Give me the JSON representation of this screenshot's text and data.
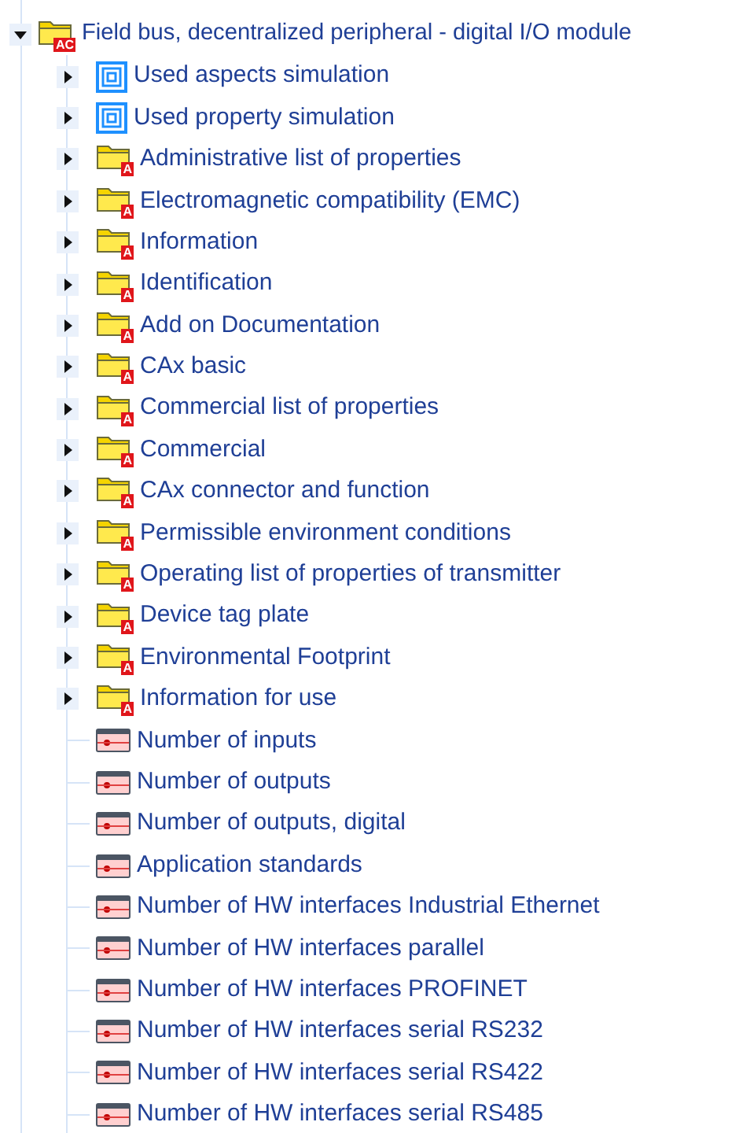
{
  "tree": {
    "label": "Field bus, decentralized peripheral - digital I/O module",
    "kind": "folder",
    "badge": "AC",
    "expanded": true,
    "children": [
      {
        "label": "Used aspects simulation",
        "kind": "collection",
        "expanded": false
      },
      {
        "label": "Used property simulation",
        "kind": "collection",
        "expanded": false
      },
      {
        "label": "Administrative list of properties",
        "kind": "folder",
        "badge": "A",
        "expanded": false
      },
      {
        "label": "Electromagnetic compatibility (EMC)",
        "kind": "folder",
        "badge": "A",
        "expanded": false
      },
      {
        "label": "Information",
        "kind": "folder",
        "badge": "A",
        "expanded": false
      },
      {
        "label": "Identification",
        "kind": "folder",
        "badge": "A",
        "expanded": false
      },
      {
        "label": "Add on Documentation",
        "kind": "folder",
        "badge": "A",
        "expanded": false
      },
      {
        "label": "CAx basic",
        "kind": "folder",
        "badge": "A",
        "expanded": false
      },
      {
        "label": "Commercial list of properties",
        "kind": "folder",
        "badge": "A",
        "expanded": false
      },
      {
        "label": "Commercial",
        "kind": "folder",
        "badge": "A",
        "expanded": false
      },
      {
        "label": "CAx connector and function",
        "kind": "folder",
        "badge": "A",
        "expanded": false
      },
      {
        "label": "Permissible environment conditions",
        "kind": "folder",
        "badge": "A",
        "expanded": false
      },
      {
        "label": "Operating list of properties of transmitter",
        "kind": "folder",
        "badge": "A",
        "expanded": false
      },
      {
        "label": "Device tag plate",
        "kind": "folder",
        "badge": "A",
        "expanded": false
      },
      {
        "label": "Environmental Footprint",
        "kind": "folder",
        "badge": "A",
        "expanded": false
      },
      {
        "label": "Information for use",
        "kind": "folder",
        "badge": "A",
        "expanded": false
      },
      {
        "label": "Number of inputs",
        "kind": "property"
      },
      {
        "label": "Number of outputs",
        "kind": "property"
      },
      {
        "label": "Number of outputs, digital",
        "kind": "property"
      },
      {
        "label": "Application standards",
        "kind": "property"
      },
      {
        "label": "Number of HW interfaces Industrial Ethernet",
        "kind": "property"
      },
      {
        "label": "Number of HW interfaces parallel",
        "kind": "property"
      },
      {
        "label": "Number of HW interfaces PROFINET",
        "kind": "property"
      },
      {
        "label": "Number of HW interfaces serial RS232",
        "kind": "property"
      },
      {
        "label": "Number of HW interfaces serial RS422",
        "kind": "property"
      },
      {
        "label": "Number of HW interfaces serial RS485",
        "kind": "property"
      }
    ]
  }
}
